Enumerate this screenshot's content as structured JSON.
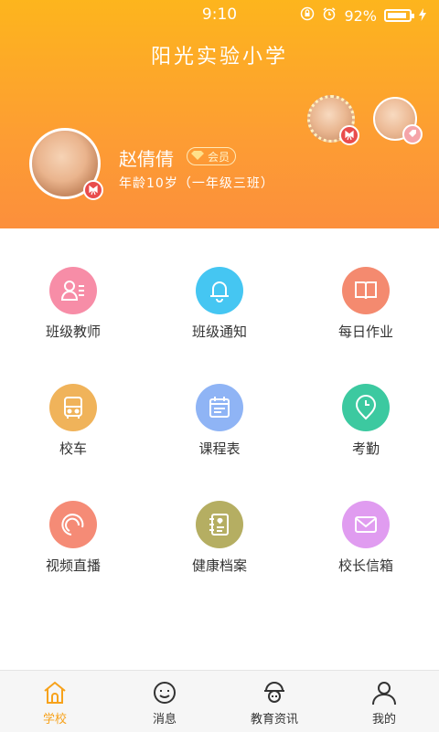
{
  "status": {
    "time": "9:10",
    "battery": "92%"
  },
  "header": {
    "school": "阳光实验小学",
    "user_name": "赵倩倩",
    "member_label": "会员",
    "user_info": "年龄10岁（一年级三班）"
  },
  "features": [
    {
      "label": "班级教师",
      "icon": "teacher-icon",
      "color": "#f78da7"
    },
    {
      "label": "班级通知",
      "icon": "bell-icon",
      "color": "#45c6f2"
    },
    {
      "label": "每日作业",
      "icon": "book-icon",
      "color": "#f48a6f"
    },
    {
      "label": "校车",
      "icon": "bus-icon",
      "color": "#f0b35a"
    },
    {
      "label": "课程表",
      "icon": "calendar-icon",
      "color": "#8fb4f5"
    },
    {
      "label": "考勤",
      "icon": "location-clock-icon",
      "color": "#3cc9a0"
    },
    {
      "label": "视频直播",
      "icon": "video-icon",
      "color": "#f58b76"
    },
    {
      "label": "健康档案",
      "icon": "health-record-icon",
      "color": "#b5ae62"
    },
    {
      "label": "校长信箱",
      "icon": "mail-icon",
      "color": "#e09cf0"
    }
  ],
  "tabs": [
    {
      "label": "学校",
      "icon": "home-icon"
    },
    {
      "label": "消息",
      "icon": "message-icon"
    },
    {
      "label": "教育资讯",
      "icon": "news-icon"
    },
    {
      "label": "我的",
      "icon": "profile-icon"
    }
  ],
  "colors": {
    "accent": "#f7a21b",
    "header_top": "#fdb51d",
    "header_bottom": "#fc8f3c"
  }
}
